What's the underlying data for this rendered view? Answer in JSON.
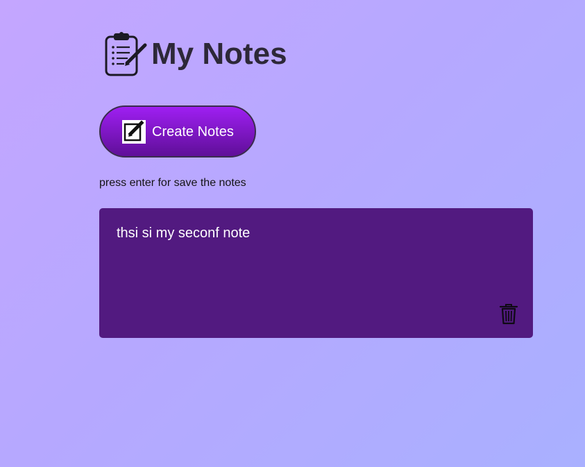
{
  "header": {
    "title": "My Notes",
    "logo_icon": "clipboard-pencil-icon"
  },
  "toolbar": {
    "create_label": "Create Notes",
    "create_icon": "edit-note-icon"
  },
  "hint": {
    "text": "press enter for save the notes"
  },
  "notes": [
    {
      "text": "thsi si my seconf note",
      "delete_icon": "trash-icon"
    }
  ],
  "colors": {
    "card": "#521a80",
    "button_top": "#9f1ff2",
    "button_bottom": "#5f0f98",
    "title": "#2d2838"
  }
}
